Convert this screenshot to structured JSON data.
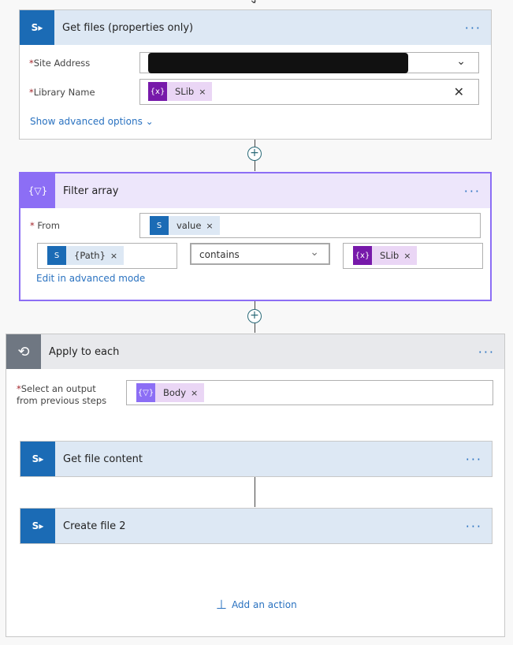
{
  "get_files": {
    "title": "Get files (properties only)",
    "site_label": "Site Address",
    "library_label": "Library Name",
    "library_token": "SLib",
    "advanced": "Show advanced options"
  },
  "filter": {
    "title": "Filter array",
    "from_label": "From",
    "from_token": "value",
    "left_token": "{Path}",
    "operator": "contains",
    "right_token": "SLib",
    "advanced": "Edit in advanced mode"
  },
  "apply": {
    "title": "Apply to each",
    "select_label_1": "Select an output",
    "select_label_2": "from previous steps",
    "token": "Body",
    "add_action": "Add an action"
  },
  "get_content": {
    "title": "Get file content"
  },
  "create_file": {
    "title": "Create file 2"
  },
  "icons": {
    "sharepoint": "sharepoint-icon",
    "variable": "variable-icon",
    "filter": "filter-icon",
    "loop": "loop-icon"
  },
  "colors": {
    "sharepoint": "#1b6bb5",
    "variable": "#7719aa",
    "filter": "#8c6ef5",
    "loop": "#6f7782",
    "link": "#2a72c0"
  }
}
